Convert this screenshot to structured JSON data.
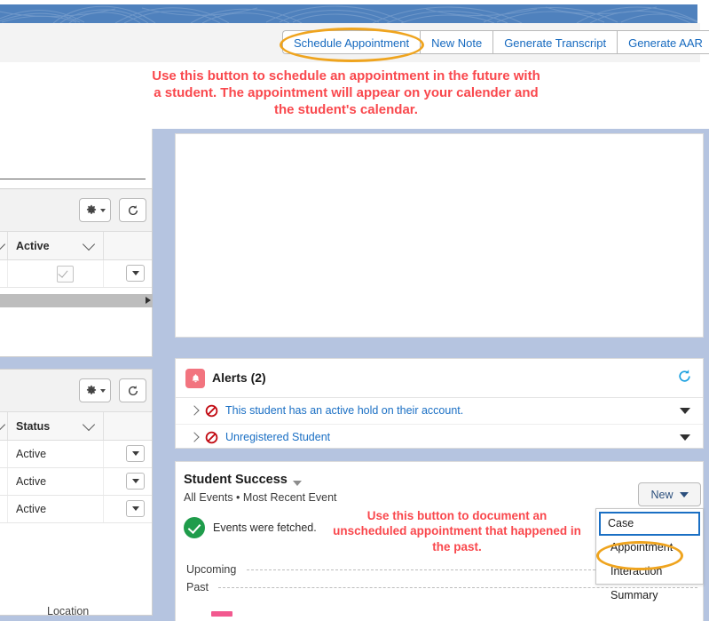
{
  "banner": {
    "pattern": "topographic-swirl",
    "color": "#4f81bd"
  },
  "toolbar": {
    "buttons": [
      {
        "label": "Schedule Appointment",
        "highlighted": true
      },
      {
        "label": "New Note",
        "highlighted": false
      },
      {
        "label": "Generate Transcript",
        "highlighted": false
      },
      {
        "label": "Generate AAR",
        "highlighted": false
      }
    ]
  },
  "annotations": {
    "top": "Use this button to schedule an appointment in the future with a student. The appointment will appear on your calender and the student's calendar.",
    "bottom": "Use this button to document an unscheduled appointment that happened in the past.",
    "color": "#f9484d",
    "highlight_color": "#efa41e"
  },
  "left_panel": {
    "table_one": {
      "column_header": "Active",
      "rows": [
        {
          "checkbox": true
        }
      ]
    },
    "table_two": {
      "column_header": "Status",
      "rows": [
        {
          "status": "Active"
        },
        {
          "status": "Active"
        },
        {
          "status": "Active"
        }
      ]
    },
    "footer_label": "Location",
    "gear_icon": "gear-icon",
    "refresh_icon": "refresh-icon"
  },
  "alerts": {
    "title": "Alerts (2)",
    "bell_icon": "bell-icon",
    "refresh_icon": "refresh-icon",
    "items": [
      {
        "text": "This student has an active hold on their account.",
        "icon": "blocked-icon"
      },
      {
        "text": "Unregistered Student",
        "icon": "blocked-icon"
      }
    ]
  },
  "student_success": {
    "title": "Student Success",
    "subtitle": "All Events • Most Recent Event",
    "status_text": "Events were fetched.",
    "status_icon": "success-check-icon",
    "timeline": {
      "upcoming_label": "Upcoming",
      "past_label": "Past"
    }
  },
  "new_menu": {
    "button_label": "New",
    "items": [
      {
        "label": "Case",
        "selected": true,
        "highlighted": false
      },
      {
        "label": "Appointment",
        "selected": false,
        "highlighted": true
      },
      {
        "label": "Interaction Summary",
        "selected": false,
        "highlighted": false
      }
    ]
  }
}
